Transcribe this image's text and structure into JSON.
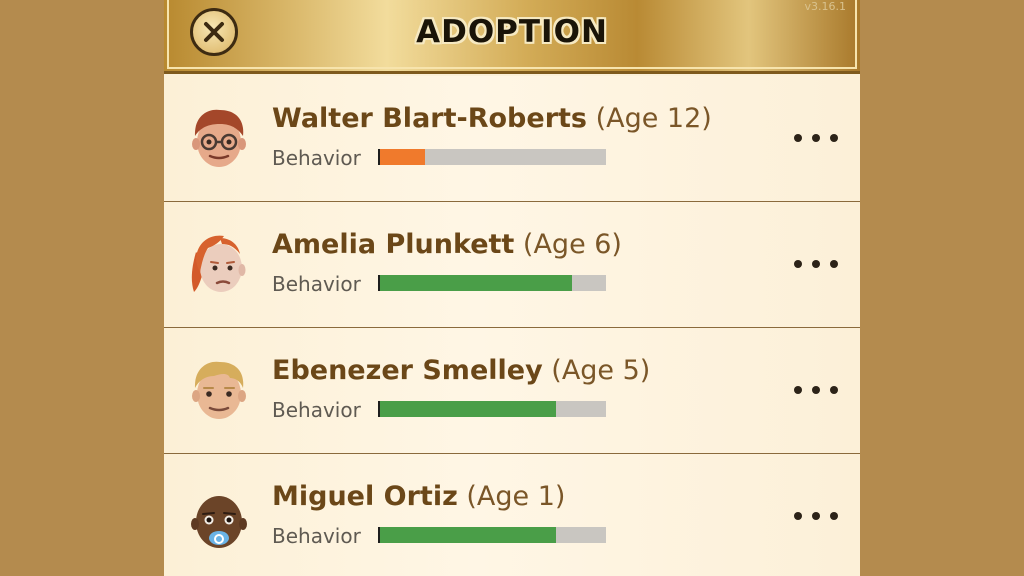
{
  "header": {
    "title": "ADOPTION",
    "version": "v3.16.1",
    "close_icon": "close-icon"
  },
  "children": [
    {
      "name": "Walter Blart-Roberts",
      "age": "(Age 12)",
      "behavior_label": "Behavior",
      "behavior_fraction": 0.2,
      "bar_color": "#f07a2c",
      "avatar_icon": "boy-glasses-face-icon"
    },
    {
      "name": "Amelia Plunkett",
      "age": "(Age 6)",
      "behavior_label": "Behavior",
      "behavior_fraction": 0.85,
      "bar_color": "#4a9e48",
      "avatar_icon": "girl-red-hair-face-icon"
    },
    {
      "name": "Ebenezer Smelley",
      "age": "(Age 5)",
      "behavior_label": "Behavior",
      "behavior_fraction": 0.78,
      "bar_color": "#4a9e48",
      "avatar_icon": "boy-blond-face-icon"
    },
    {
      "name": "Miguel Ortiz",
      "age": "(Age 1)",
      "behavior_label": "Behavior",
      "behavior_fraction": 0.78,
      "bar_color": "#4a9e48",
      "avatar_icon": "baby-pacifier-face-icon"
    }
  ],
  "row_menu_icon": "more-options-icon"
}
